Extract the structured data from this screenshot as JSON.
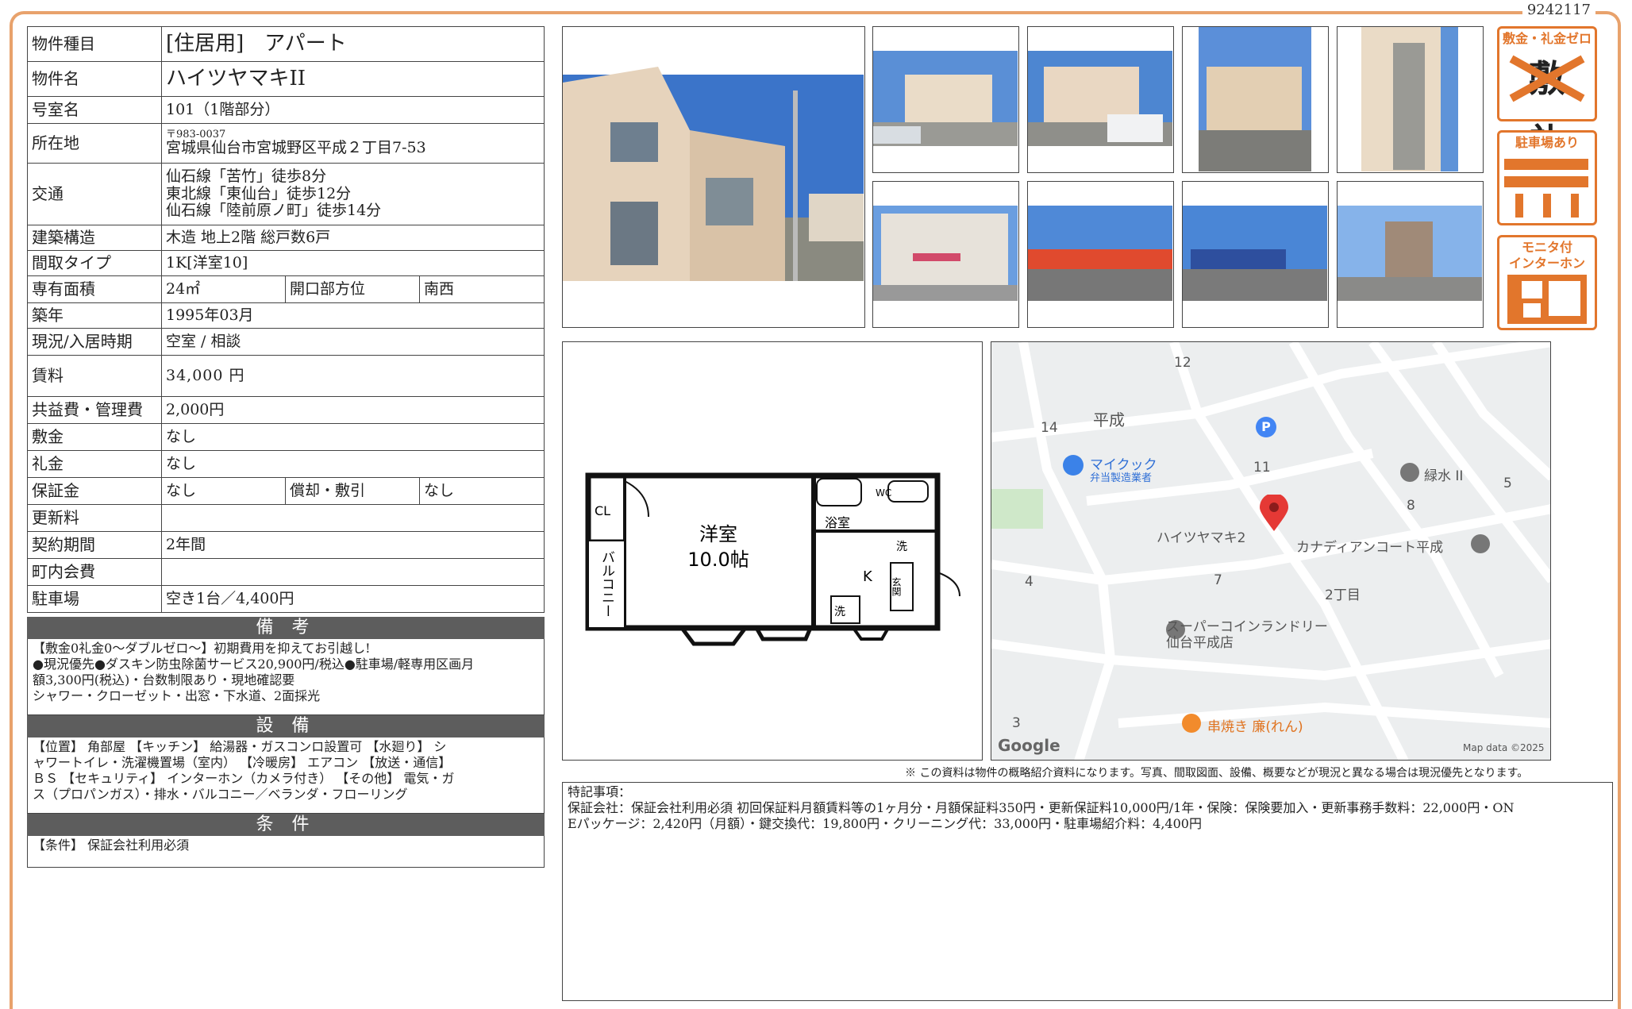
{
  "doc_id": "9242117",
  "table": {
    "type_label": "物件種目",
    "type_value": "[住居用]　アパート",
    "name_label": "物件名",
    "name_value": "ハイツヤマキII",
    "room_label": "号室名",
    "room_value": "101（1階部分）",
    "addr_label": "所在地",
    "zip": "〒983-0037",
    "addr_value": "宮城県仙台市宮城野区平成２丁目7-53",
    "traffic_label": "交通",
    "traffic": [
      "仙石線「苦竹」徒歩8分",
      "東北線「東仙台」徒歩12分",
      "仙石線「陸前原ノ町」徒歩14分"
    ],
    "struct_label": "建築構造",
    "struct_value": "木造 地上2階 総戸数6戸",
    "layout_label": "間取タイプ",
    "layout_value": "1K[洋室10]",
    "area_label": "専有面積",
    "area_value": "24㎡",
    "dir_label": "開口部方位",
    "dir_value": "南西",
    "built_label": "築年",
    "built_value": "1995年03月",
    "status_label": "現況/入居時期",
    "status_value": "空室 /  相談",
    "rent_label": "賃料",
    "rent_value": "34,000 円",
    "fee_label": "共益費・管理費",
    "fee_value": "2,000円",
    "deposit_label": "敷金",
    "deposit_value": "なし",
    "keymoney_label": "礼金",
    "keymoney_value": "なし",
    "guarantee_label": "保証金",
    "guarantee_value": "なし",
    "amort_label": "償却・敷引",
    "amort_value": "なし",
    "renew_label": "更新料",
    "renew_value": "",
    "term_label": "契約期間",
    "term_value": "2年間",
    "town_label": "町内会費",
    "town_value": "",
    "parking_label": "駐車場",
    "parking_value": "空き1台／4,400円"
  },
  "remarks": {
    "header": "備 考",
    "lines": [
      "【敷金0礼金0～ダブルゼロ～】初期費用を抑えてお引越し!",
      "●現況優先●ダスキン防虫除菌サービス20,900円/税込●駐車場/軽専用区画月",
      "額3,300円(税込)・台数制限あり・現地確認要",
      "シャワー・クローゼット・出窓・下水道、2面採光"
    ]
  },
  "equipment": {
    "header": "設 備",
    "lines": [
      "【位置】 角部屋 【キッチン】 給湯器・ガスコンロ設置可 【水廻り】 シ",
      "ャワートイレ・洗濯機置場（室内） 【冷暖房】 エアコン 【放送・通信】",
      "ＢＳ 【セキュリティ】 インターホン（カメラ付き） 【その他】 電気・ガ",
      "ス（プロパンガス）・排水・バルコニー／ベランダ・フローリング"
    ]
  },
  "conditions": {
    "header": "条 件",
    "text": "【条件】 保証会社利用必須"
  },
  "badges": {
    "b1_title": "敷金・礼金ゼロ",
    "b1_chars": "敷　礼",
    "b2_title": "駐車場あり",
    "b3_title": "モニタ付\nインターホン"
  },
  "floorplan": {
    "room": "洋室",
    "size": "10.0帖",
    "cl": "CL",
    "balcony": "バルコニー",
    "bath": "浴室",
    "wc": "WC",
    "k": "K",
    "entrance": "玄関",
    "wash": "洗",
    "laundry": "洗"
  },
  "map": {
    "area": "平成",
    "n12": "12",
    "n14": "14",
    "n11": "11",
    "n5": "5",
    "n8": "8",
    "n4": "4",
    "n7": "7",
    "n3": "3",
    "chome": "2丁目",
    "poi_mycook": "マイクック",
    "poi_mycook_sub": "弁当製造業者",
    "poi_midori": "緑水 II",
    "poi_heights": "ハイツヤマキ2",
    "poi_canadian": "カナディアンコート平成",
    "poi_laundry": "スーパーコインランドリー",
    "poi_laundry_sub": "仙台平成店",
    "poi_kushi": "串焼き 廉(れん)",
    "parking_p": "P",
    "google": "Google",
    "mapdata": "Map data ©2025"
  },
  "notice": "※ この資料は物件の概略紹介資料になります。写真、間取図面、設備、概要などが現況と異なる場合は現況優先となります。",
  "notes": {
    "line1": "特記事項：",
    "line2": "保証会社：保証会社利用必須 初回保証料月額賃料等の1ヶ月分・月額保証料350円・更新保証料10,000円/1年・保険：保険要加入・更新事務手数料：22,000円・ON",
    "line3": "Eパッケージ：2,420円（月額）・鍵交換代：19,800円・クリーニング代：33,000円・駐車場紹介料：4,400円"
  }
}
